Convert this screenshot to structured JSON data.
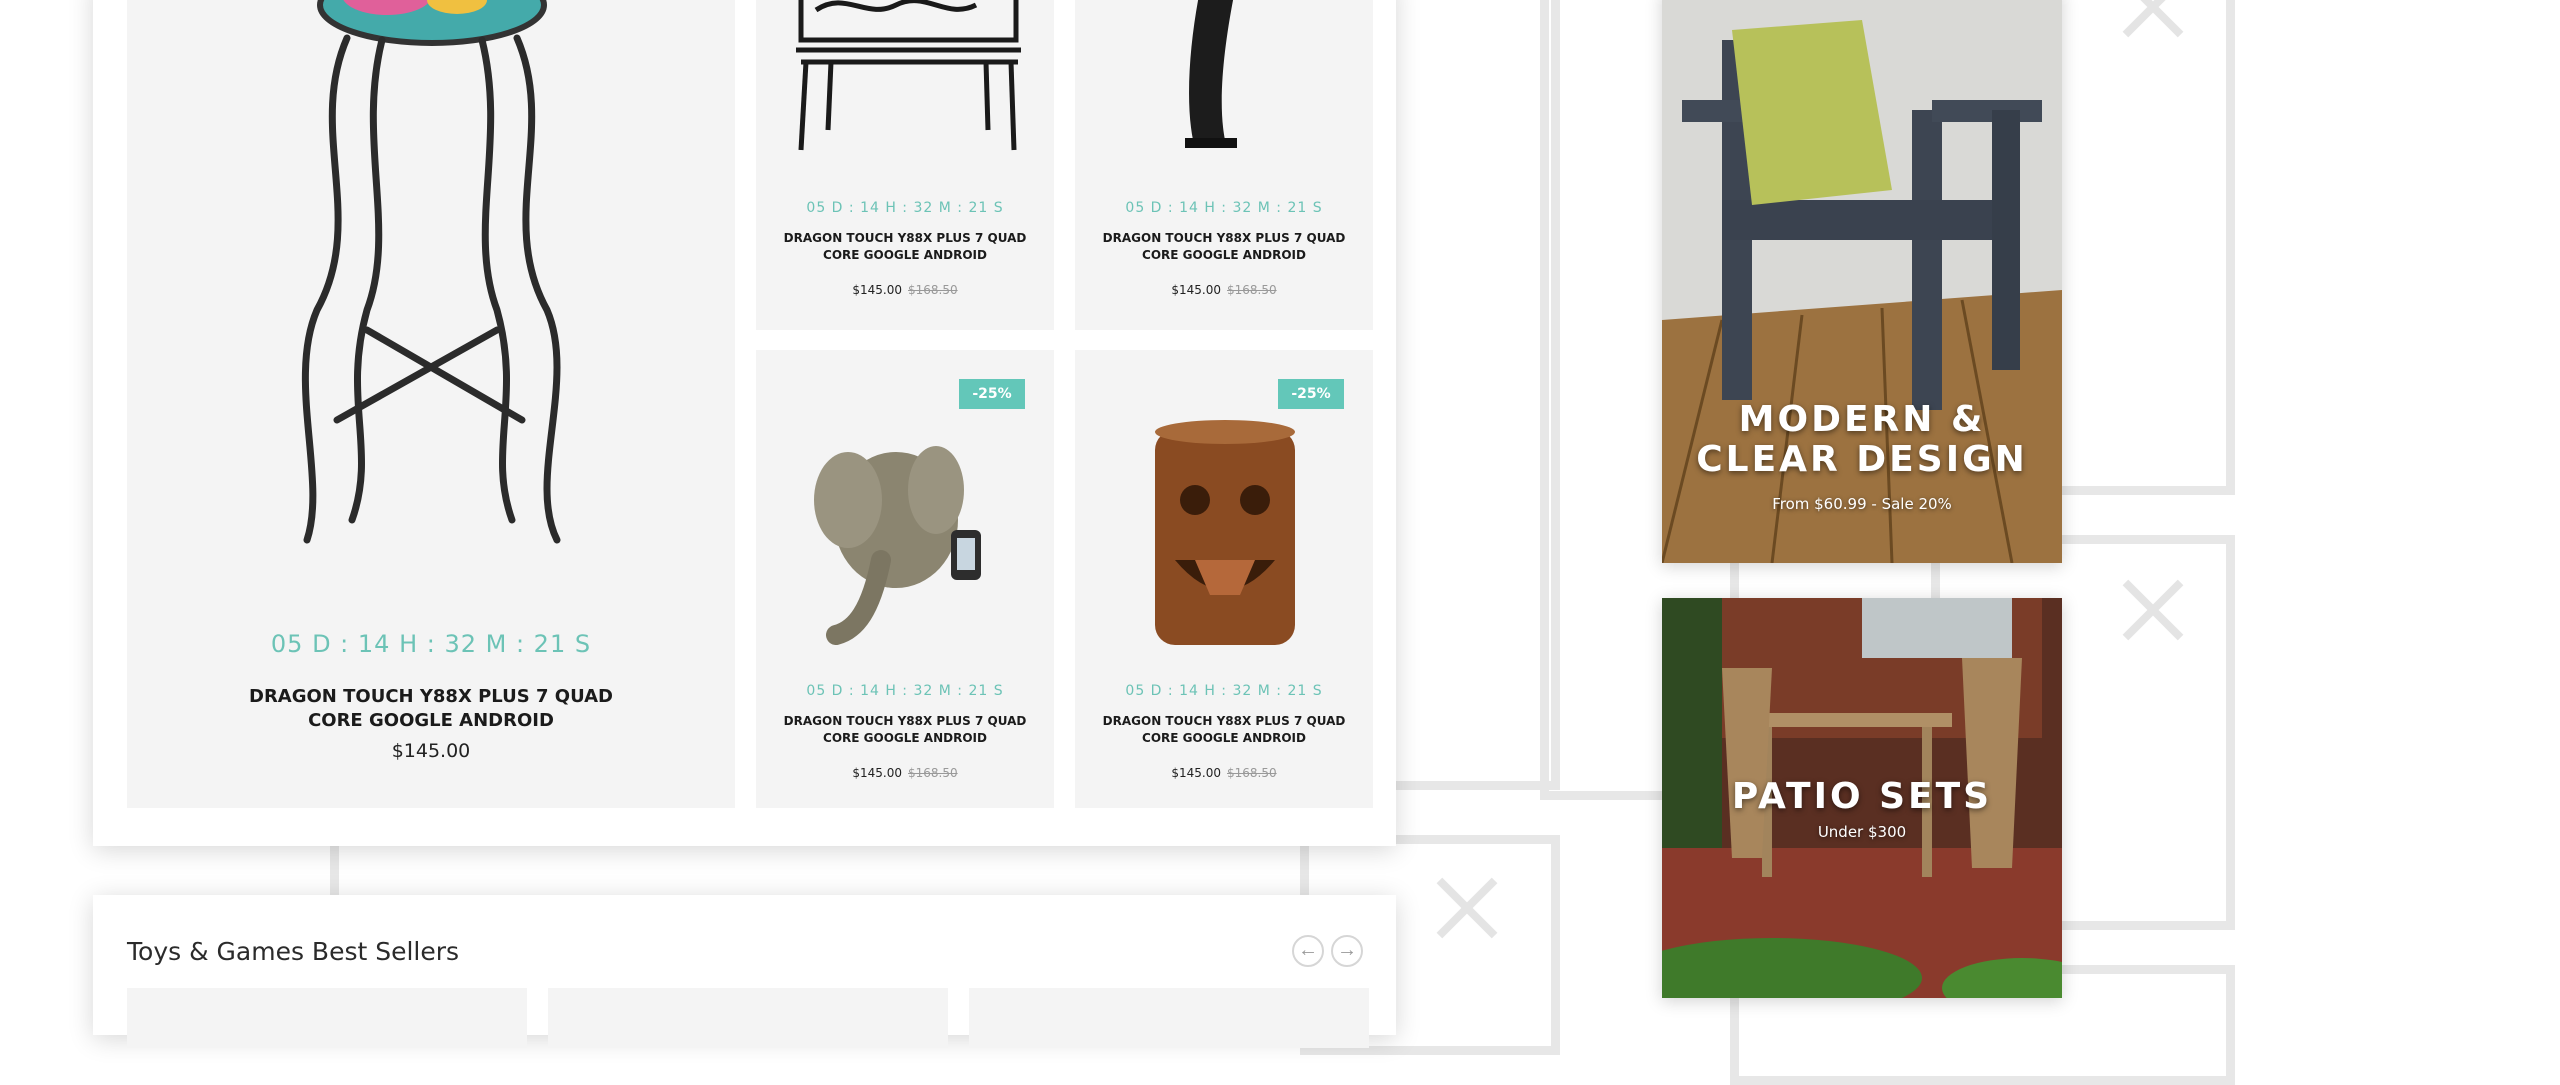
{
  "deals": {
    "featured": {
      "timer": "05 D  :  14 H  :  32 M  :  21 S",
      "name": "DRAGON TOUCH Y88X PLUS 7 QUAD CORE GOOGLE ANDROID",
      "price": "$145.00"
    },
    "items": [
      {
        "timer": "05 D  :  14 H  :  32 M  :  21 S",
        "name": "DRAGON TOUCH Y88X PLUS 7 QUAD CORE GOOGLE ANDROID",
        "price": "$145.00",
        "old_price": "$168.50",
        "image": "bench-icon"
      },
      {
        "timer": "05 D  :  14 H  :  32 M  :  21 S",
        "name": "DRAGON TOUCH Y88X PLUS 7 QUAD CORE GOOGLE ANDROID",
        "price": "$145.00",
        "old_price": "$168.50",
        "image": "lamp-icon"
      },
      {
        "timer": "05 D  :  14 H  :  32 M  :  21 S",
        "name": "DRAGON TOUCH Y88X PLUS 7 QUAD CORE GOOGLE ANDROID",
        "price": "$145.00",
        "old_price": "$168.50",
        "badge": "-25%",
        "image": "elephant-icon"
      },
      {
        "timer": "05 D  :  14 H  :  32 M  :  21 S",
        "name": "DRAGON TOUCH Y88X PLUS 7 QUAD CORE GOOGLE ANDROID",
        "price": "$145.00",
        "old_price": "$168.50",
        "badge": "-25%",
        "image": "tiki-icon"
      }
    ]
  },
  "promos": [
    {
      "title": "MODERN & CLEAR DESIGN",
      "subtitle": "From $60.99 - Sale 20%"
    },
    {
      "title": "PATIO SETS",
      "subtitle": "Under $300"
    }
  ],
  "bestsellers": {
    "title": "Toys & Games Best Sellers",
    "prev_icon": "arrow-left-icon",
    "next_icon": "arrow-right-icon"
  },
  "colors": {
    "accent": "#63c7b9",
    "tile_bg": "#f4f4f4"
  }
}
